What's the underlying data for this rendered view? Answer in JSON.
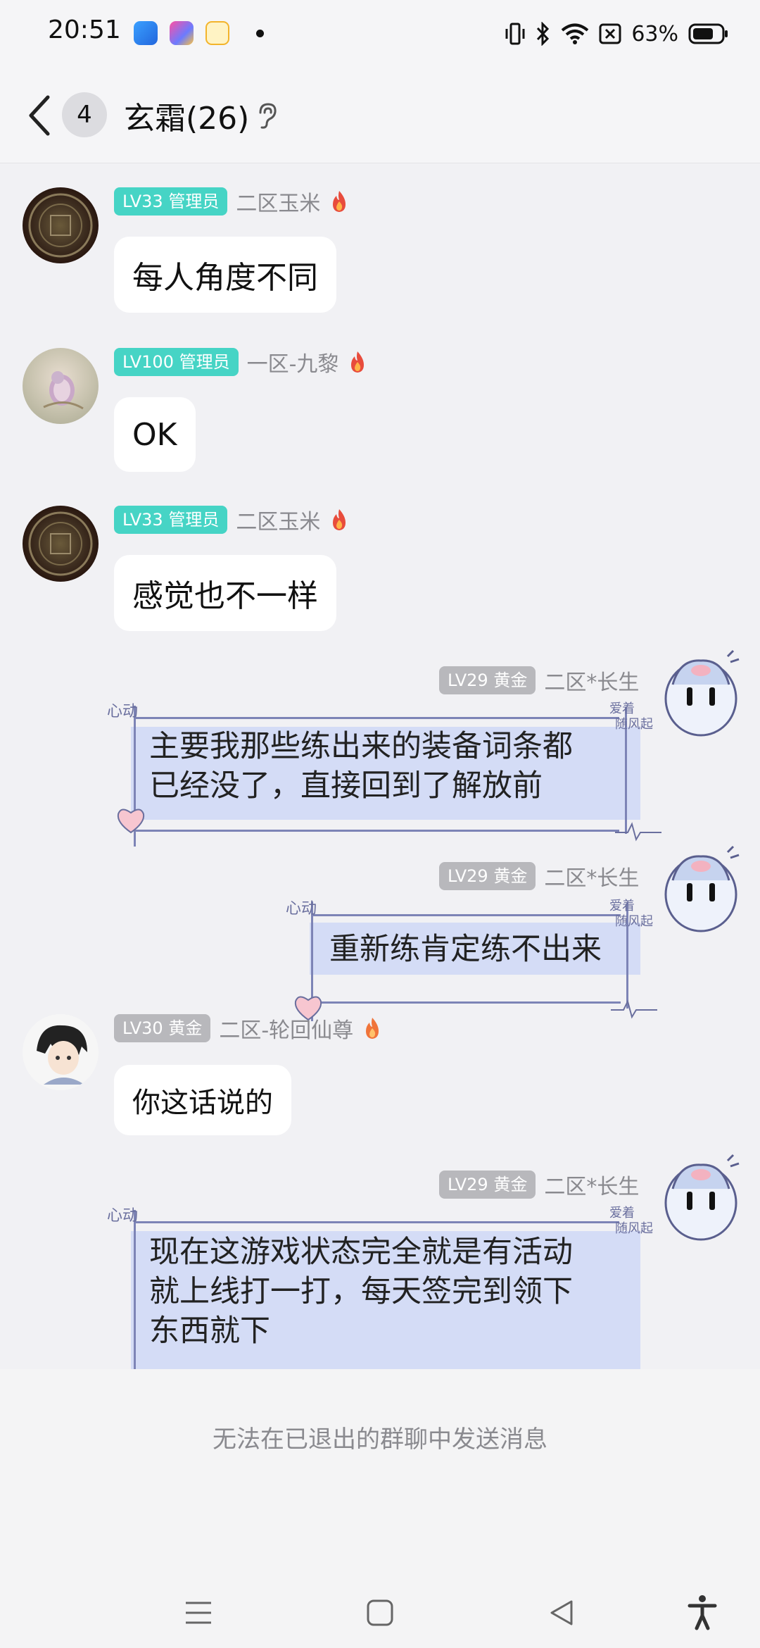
{
  "status_bar": {
    "time": "20:51",
    "battery": "63%",
    "icons": [
      "vibrate-icon",
      "bluetooth-icon",
      "wifi-icon",
      "no-sim-icon",
      "battery-icon"
    ]
  },
  "header": {
    "unread_count": "4",
    "title": "玄霜(26)",
    "ear_icon": "ear-icon"
  },
  "messages": [
    {
      "level": "LV33 管理员",
      "name": "二区玉米",
      "text": "每人角度不同"
    },
    {
      "level": "LV100 管理员",
      "name": "一区-九黎",
      "text": "OK"
    },
    {
      "level": "LV33 管理员",
      "name": "二区玉米",
      "text": "感觉也不一样"
    },
    {
      "level": "LV29 黄金",
      "name": "二区*长生",
      "lines": [
        "主要我那些练出来的装备词条都",
        "已经没了，直接回到了解放前"
      ]
    },
    {
      "level": "LV29 黄金",
      "name": "二区*长生",
      "lines": [
        "重新练肯定练不出来"
      ]
    },
    {
      "level": "LV30 黄金",
      "name": "二区-轮回仙尊",
      "text": "你这话说的"
    },
    {
      "level": "LV29 黄金",
      "name": "二区*长生",
      "lines": [
        "现在这游戏状态完全就是有活动",
        "就上线打一打，每天签完到领下",
        "东西就下"
      ]
    }
  ],
  "bubble_decor_text": [
    "心动",
    "爱着",
    "随风起"
  ],
  "footer": {
    "notice": "无法在已退出的群聊中发送消息"
  },
  "colors": {
    "admin_badge": "#46d4c5",
    "gold_badge": "#b8b8bc",
    "decor_fill": "#d4dcf6",
    "decor_line": "#7d84b6"
  }
}
